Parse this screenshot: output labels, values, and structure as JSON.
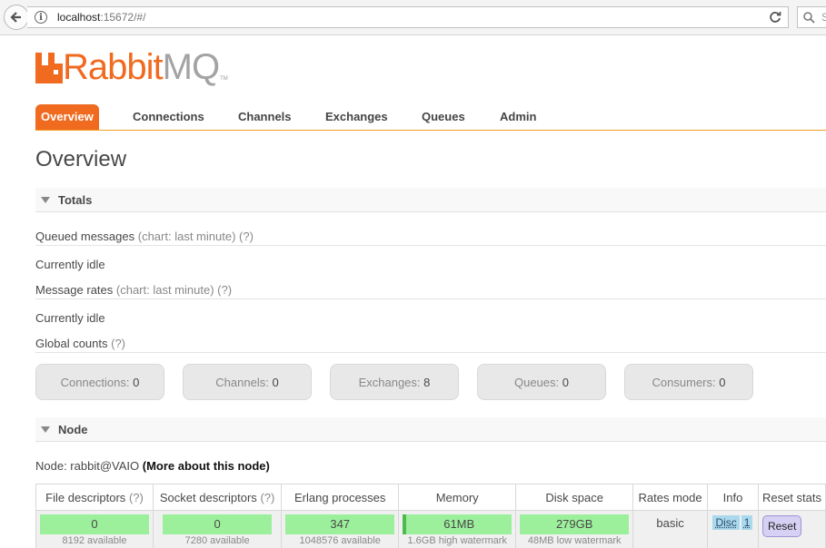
{
  "browser": {
    "url_host": "localhost",
    "url_rest": ":15672/#/",
    "search_placeholder": "S"
  },
  "logo": {
    "part1": "Rabbit",
    "part2": "MQ",
    "tm": "TM"
  },
  "nav": {
    "items": [
      {
        "label": "Overview",
        "active": true
      },
      {
        "label": "Connections"
      },
      {
        "label": "Channels"
      },
      {
        "label": "Exchanges"
      },
      {
        "label": "Queues"
      },
      {
        "label": "Admin"
      }
    ]
  },
  "page_title": "Overview",
  "totals": {
    "header": "Totals",
    "queued_label": "Queued messages",
    "queued_chart": "(chart: last minute)",
    "queued_help": "(?)",
    "queued_status": "Currently idle",
    "rates_label": "Message rates",
    "rates_chart": "(chart: last minute)",
    "rates_help": "(?)",
    "rates_status": "Currently idle",
    "global_label": "Global counts",
    "global_help": "(?)",
    "counts": [
      {
        "label": "Connections:",
        "value": "0"
      },
      {
        "label": "Channels:",
        "value": "0"
      },
      {
        "label": "Exchanges:",
        "value": "8"
      },
      {
        "label": "Queues:",
        "value": "0"
      },
      {
        "label": "Consumers:",
        "value": "0"
      }
    ]
  },
  "node": {
    "header": "Node",
    "node_label": "Node: rabbit@VAIO",
    "more_link": "(More about this node)",
    "columns": {
      "file_desc": "File descriptors",
      "socket_desc": "Socket descriptors",
      "help": "(?)",
      "erlang": "Erlang processes",
      "memory": "Memory",
      "disk": "Disk space",
      "rates_mode": "Rates mode",
      "info": "Info",
      "reset": "Reset stats"
    },
    "values": {
      "file_desc": "0",
      "file_desc_sub": "8192 available",
      "socket_desc": "0",
      "socket_desc_sub": "7280 available",
      "erlang": "347",
      "erlang_sub": "1048576 available",
      "memory": "61MB",
      "memory_sub": "1.6GB high watermark",
      "disk": "279GB",
      "disk_sub": "48MB low watermark",
      "rates_mode": "basic",
      "info_disc": "Disc",
      "info_num": "1",
      "reset_btn": "Reset"
    }
  }
}
